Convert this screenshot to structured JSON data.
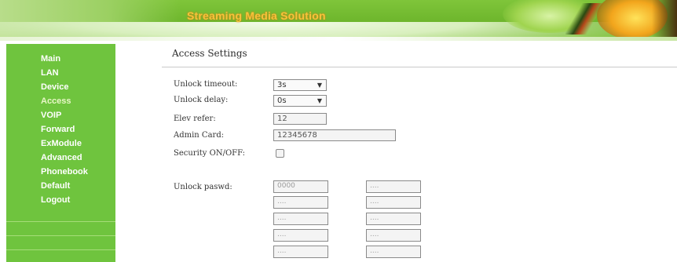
{
  "banner": {
    "title": "Streaming Media Solution"
  },
  "sidebar": {
    "items": [
      {
        "label": "Main"
      },
      {
        "label": "LAN"
      },
      {
        "label": "Device"
      },
      {
        "label": "Access"
      },
      {
        "label": "VOIP"
      },
      {
        "label": "Forward"
      },
      {
        "label": "ExModule"
      },
      {
        "label": "Advanced"
      },
      {
        "label": "Phonebook"
      },
      {
        "label": "Default"
      },
      {
        "label": "Logout"
      }
    ]
  },
  "page": {
    "title": "Access Settings",
    "unlock_timeout": {
      "label": "Unlock timeout:",
      "value": "3s"
    },
    "unlock_delay": {
      "label": "Unlock delay:",
      "value": "0s"
    },
    "elev_refer": {
      "label": "Elev refer:",
      "value": "12"
    },
    "admin_card": {
      "label": "Admin Card:",
      "value": "12345678"
    },
    "security": {
      "label": "Security ON/OFF:",
      "checked": false
    },
    "unlock_passwd": {
      "label": "Unlock paswd:",
      "left": [
        "0000",
        "....",
        "....",
        "....",
        "...."
      ],
      "right": [
        "....",
        "....",
        "....",
        "....",
        "...."
      ]
    }
  }
}
